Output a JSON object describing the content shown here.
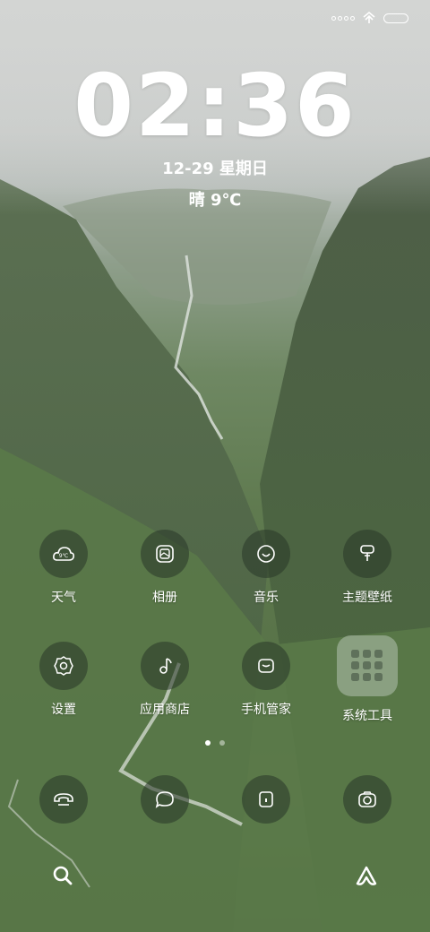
{
  "status_bar": {
    "signal_icon": "signal-dots-icon",
    "wifi_icon": "wifi-icon",
    "battery_icon": "battery-icon"
  },
  "lockscreen": {
    "time": "02:36",
    "date": "12-29 星期日",
    "weather": "晴 9℃"
  },
  "apps": [
    {
      "label": "天气",
      "icon": "weather-icon"
    },
    {
      "label": "相册",
      "icon": "gallery-icon"
    },
    {
      "label": "音乐",
      "icon": "music-icon"
    },
    {
      "label": "主题壁纸",
      "icon": "theme-icon"
    },
    {
      "label": "设置",
      "icon": "settings-icon"
    },
    {
      "label": "应用商店",
      "icon": "app-store-icon"
    },
    {
      "label": "手机管家",
      "icon": "security-icon"
    },
    {
      "label": "系统工具",
      "icon": "folder-icon"
    }
  ],
  "page_indicator": {
    "pages": 2,
    "active": 1
  },
  "dock": [
    {
      "icon": "phone-icon"
    },
    {
      "icon": "messages-icon"
    },
    {
      "icon": "browser-icon"
    },
    {
      "icon": "camera-icon"
    }
  ],
  "bottom_bar": {
    "left_icon": "search-icon",
    "right_icon": "assistant-icon"
  }
}
